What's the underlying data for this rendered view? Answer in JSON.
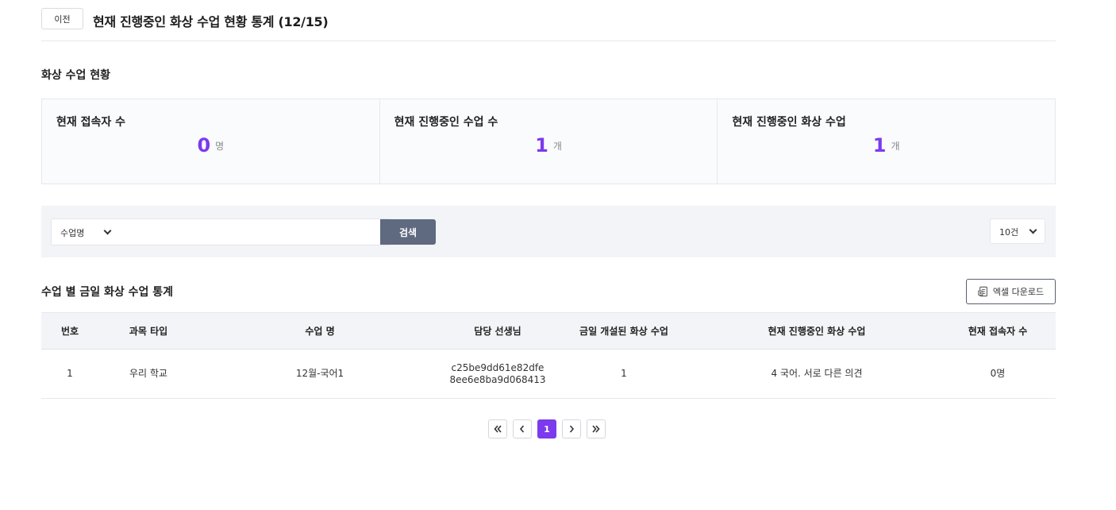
{
  "header": {
    "back_label": "이전",
    "title": "현재 진행중인 화상 수업 현황 통계 (12/15)"
  },
  "status_section": {
    "title": "화상 수업 현황",
    "stats": [
      {
        "label": "현재 접속자 수",
        "value": "0",
        "unit": "명"
      },
      {
        "label": "현재 진행중인 수업 수",
        "value": "1",
        "unit": "개"
      },
      {
        "label": "현재 진행중인 화상 수업",
        "value": "1",
        "unit": "개"
      }
    ]
  },
  "search": {
    "field_selected": "수업명",
    "query": "",
    "button_label": "검색",
    "page_size": "10건"
  },
  "table_section": {
    "title": "수업 별 금일 화상 수업 통계",
    "excel_label": "엑셀 다운로드",
    "columns": [
      "번호",
      "과목 타입",
      "수업 명",
      "담당 선생님",
      "금일 개설된 화상 수업",
      "현재 진행중인 화상 수업",
      "현재 접속자 수"
    ],
    "rows": [
      {
        "num": "1",
        "subject_type": "우리 학교",
        "class_name": "12월-국어1",
        "teacher": "c25be9dd61e82dfe8ee6e8ba9d068413",
        "today_count": "1",
        "current_class": "4 국어. 서로 다른 의견",
        "current_users": "0명"
      }
    ]
  },
  "pagination": {
    "current_page": "1"
  },
  "colors": {
    "accent": "#7c3aed",
    "search_button": "#5f6a80",
    "panel_bg": "#f3f4f7"
  }
}
